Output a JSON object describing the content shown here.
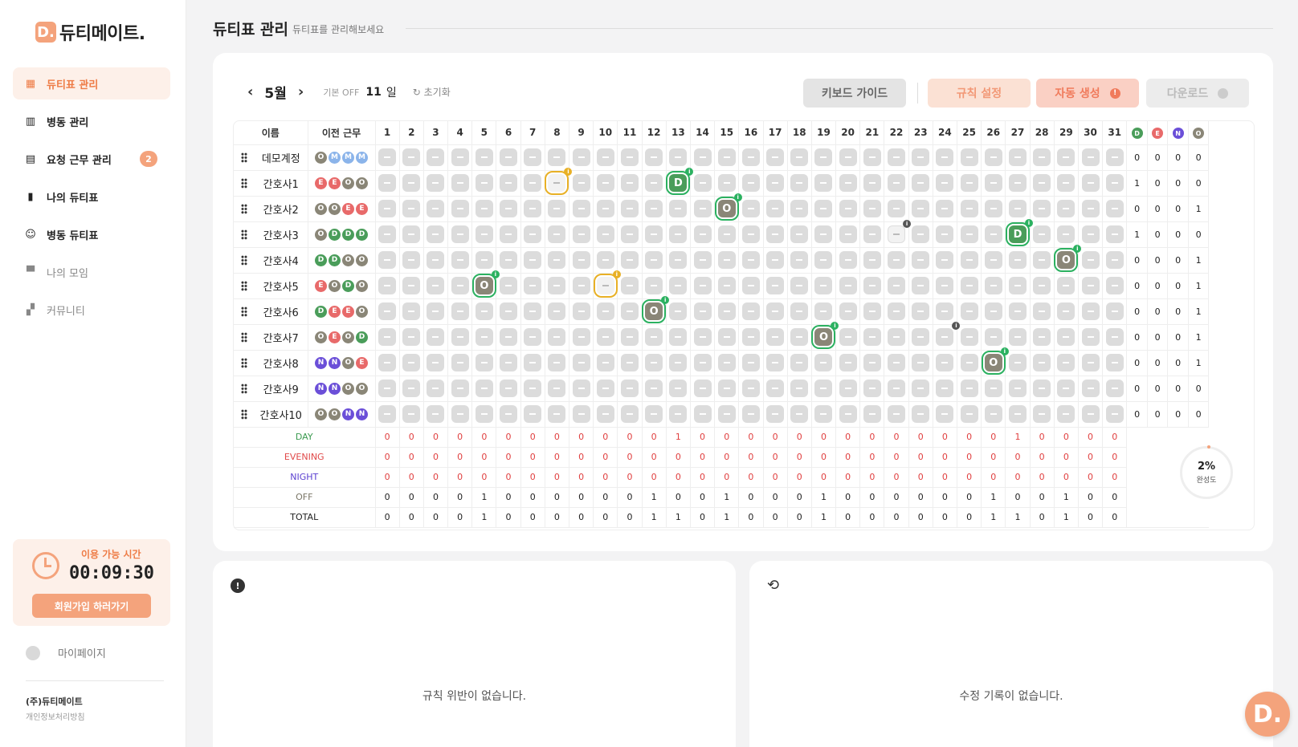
{
  "app": {
    "logo_letter": "D.",
    "name": "듀티메이트."
  },
  "nav": [
    {
      "label": "듀티표 관리",
      "icon": "calendar-icon",
      "active": true,
      "dim": false,
      "badge": ""
    },
    {
      "label": "병동 관리",
      "icon": "building-icon",
      "active": false,
      "dim": false,
      "badge": ""
    },
    {
      "label": "요청 근무 관리",
      "icon": "request-icon",
      "active": false,
      "dim": false,
      "badge": "2"
    },
    {
      "label": "나의 듀티표",
      "icon": "bookmark-icon",
      "active": false,
      "dim": false,
      "badge": ""
    },
    {
      "label": "병동 듀티표",
      "icon": "people-icon",
      "active": false,
      "dim": false,
      "badge": ""
    },
    {
      "label": "나의 모임",
      "icon": "cup-icon",
      "active": false,
      "dim": true,
      "badge": ""
    },
    {
      "label": "커뮤니티",
      "icon": "chat-icon",
      "active": false,
      "dim": true,
      "badge": ""
    }
  ],
  "timer": {
    "label": "이용 가능 시간",
    "value": "00:09:30",
    "signup": "회원가입 하러가기"
  },
  "mypage": "마이페이지",
  "company": "(주)듀티메이트",
  "privacy": "개인정보처리방침",
  "header": {
    "title": "듀티표 관리",
    "subtitle": "듀티표를 관리해보세요"
  },
  "toolbar": {
    "month": "5월",
    "off_label": "기본 OFF",
    "off_value": "11",
    "off_unit": "일",
    "reset": "초기화",
    "guide": "키보드 가이드",
    "rule": "규칙 설정",
    "auto": "자동 생성",
    "download": "다운로드"
  },
  "table": {
    "col_name": "이름",
    "col_prev": "이전 근무",
    "days": [
      1,
      2,
      3,
      4,
      5,
      6,
      7,
      8,
      9,
      10,
      11,
      12,
      13,
      14,
      15,
      16,
      17,
      18,
      19,
      20,
      21,
      22,
      23,
      24,
      25,
      26,
      27,
      28,
      29,
      30,
      31
    ],
    "day_colors": {
      "3": "blue",
      "4": "red",
      "5": "red",
      "6": "red",
      "10": "blue",
      "11": "red",
      "17": "blue",
      "18": "red",
      "24": "blue",
      "25": "red",
      "31": "blue"
    },
    "count_headers": [
      {
        "t": "D",
        "c": "#4a9d5a"
      },
      {
        "t": "E",
        "c": "#e86a6a"
      },
      {
        "t": "N",
        "c": "#6b4fd8"
      },
      {
        "t": "O",
        "c": "#8a8677"
      }
    ],
    "nurses": [
      {
        "name": "데모계정",
        "prev": [
          "O",
          "M",
          "M",
          "M"
        ],
        "counts": [
          0,
          0,
          0,
          0
        ],
        "cells": {}
      },
      {
        "name": "간호사1",
        "prev": [
          "E",
          "E",
          "O",
          "O"
        ],
        "counts": [
          1,
          0,
          0,
          0
        ],
        "cells": {
          "8": "pend",
          "13": "D"
        }
      },
      {
        "name": "간호사2",
        "prev": [
          "O",
          "O",
          "E",
          "E"
        ],
        "counts": [
          0,
          0,
          0,
          1
        ],
        "cells": {
          "15": "O"
        }
      },
      {
        "name": "간호사3",
        "prev": [
          "O",
          "D",
          "D",
          "D"
        ],
        "counts": [
          1,
          0,
          0,
          0
        ],
        "cells": {
          "22": "empty",
          "27": "D"
        }
      },
      {
        "name": "간호사4",
        "prev": [
          "D",
          "D",
          "O",
          "O"
        ],
        "counts": [
          0,
          0,
          0,
          1
        ],
        "cells": {
          "29": "O"
        }
      },
      {
        "name": "간호사5",
        "prev": [
          "E",
          "O",
          "D",
          "O"
        ],
        "counts": [
          0,
          0,
          0,
          1
        ],
        "cells": {
          "5": "O",
          "10": "pend"
        }
      },
      {
        "name": "간호사6",
        "prev": [
          "D",
          "E",
          "E",
          "O"
        ],
        "counts": [
          0,
          0,
          0,
          1
        ],
        "cells": {
          "12": "O"
        }
      },
      {
        "name": "간호사7",
        "prev": [
          "O",
          "E",
          "O",
          "D"
        ],
        "counts": [
          0,
          0,
          0,
          1
        ],
        "cells": {
          "19": "O",
          "24": "dark"
        }
      },
      {
        "name": "간호사8",
        "prev": [
          "N",
          "N",
          "O",
          "E"
        ],
        "counts": [
          0,
          0,
          0,
          1
        ],
        "cells": {
          "26": "O"
        }
      },
      {
        "name": "간호사9",
        "prev": [
          "N",
          "N",
          "O",
          "O"
        ],
        "counts": [
          0,
          0,
          0,
          0
        ],
        "cells": {}
      },
      {
        "name": "간호사10",
        "prev": [
          "O",
          "O",
          "N",
          "N"
        ],
        "counts": [
          0,
          0,
          0,
          0
        ],
        "cells": {}
      }
    ],
    "summary": [
      {
        "label": "DAY",
        "color": "#3a9a4f",
        "values": [
          0,
          0,
          0,
          0,
          0,
          0,
          0,
          0,
          0,
          0,
          0,
          0,
          1,
          0,
          0,
          0,
          0,
          0,
          0,
          0,
          0,
          0,
          0,
          0,
          0,
          0,
          1,
          0,
          0,
          0,
          0
        ]
      },
      {
        "label": "EVENING",
        "color": "#e04848",
        "values": [
          0,
          0,
          0,
          0,
          0,
          0,
          0,
          0,
          0,
          0,
          0,
          0,
          0,
          0,
          0,
          0,
          0,
          0,
          0,
          0,
          0,
          0,
          0,
          0,
          0,
          0,
          0,
          0,
          0,
          0,
          0
        ]
      },
      {
        "label": "NIGHT",
        "color": "#5a3fd0",
        "values": [
          0,
          0,
          0,
          0,
          0,
          0,
          0,
          0,
          0,
          0,
          0,
          0,
          0,
          0,
          0,
          0,
          0,
          0,
          0,
          0,
          0,
          0,
          0,
          0,
          0,
          0,
          0,
          0,
          0,
          0,
          0
        ]
      },
      {
        "label": "OFF",
        "color": "#7a7666",
        "values": [
          0,
          0,
          0,
          0,
          1,
          0,
          0,
          0,
          0,
          0,
          0,
          1,
          0,
          0,
          1,
          0,
          0,
          0,
          1,
          0,
          0,
          0,
          0,
          0,
          0,
          1,
          0,
          0,
          1,
          0,
          0
        ]
      },
      {
        "label": "TOTAL",
        "color": "#222222",
        "values": [
          0,
          0,
          0,
          0,
          1,
          0,
          0,
          0,
          0,
          0,
          0,
          1,
          1,
          0,
          1,
          0,
          0,
          0,
          1,
          0,
          0,
          0,
          0,
          0,
          0,
          1,
          1,
          0,
          1,
          0,
          0
        ]
      }
    ],
    "completion": {
      "value": "2%",
      "label": "완성도"
    }
  },
  "panels": {
    "violations_msg": "규칙 위반이 없습니다.",
    "history_msg": "수정 기록이 없습니다."
  },
  "float_letter": "D."
}
